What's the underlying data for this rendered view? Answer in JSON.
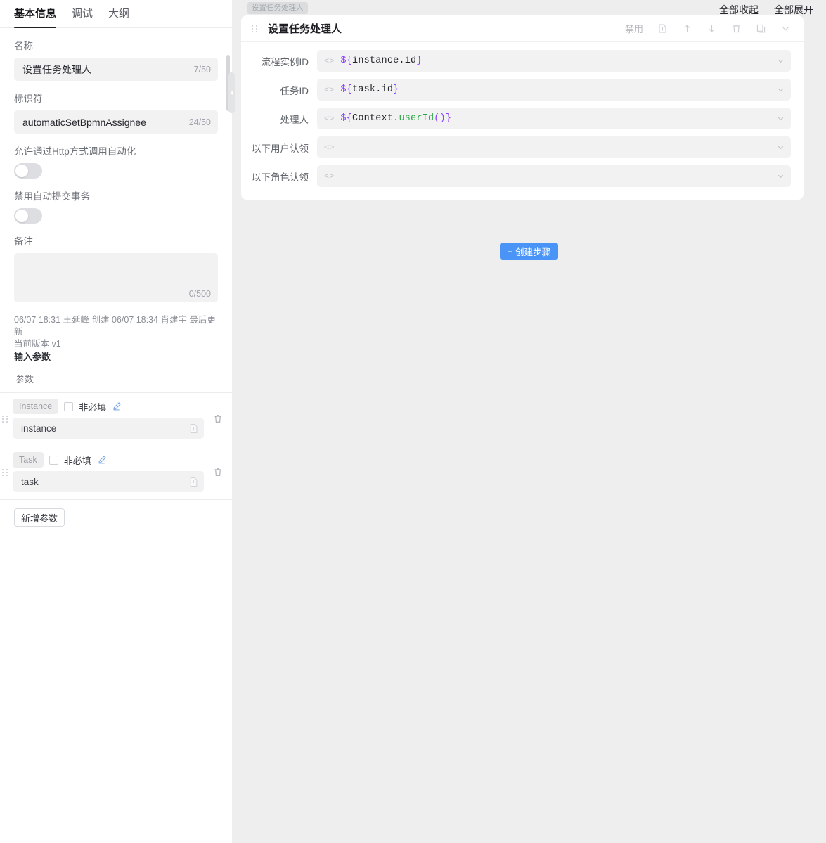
{
  "left": {
    "tabs": [
      {
        "label": "基本信息",
        "active": true
      },
      {
        "label": "调试",
        "active": false
      },
      {
        "label": "大纲",
        "active": false
      }
    ],
    "name": {
      "label": "名称",
      "value": "设置任务处理人",
      "counter": "7/50"
    },
    "identifier": {
      "label": "标识符",
      "value": "automaticSetBpmnAssignee",
      "counter": "24/50"
    },
    "http_toggle": {
      "label": "允许通过Http方式调用自动化",
      "state": "off"
    },
    "auto_commit_toggle": {
      "label": "禁用自动提交事务",
      "state": "off"
    },
    "remark": {
      "label": "备注",
      "value": "",
      "counter": "0/500"
    },
    "meta": {
      "history": "06/07 18:31 王延峰 创建 06/07 18:34 肖建宇 最后更新",
      "version": "当前版本 v1"
    },
    "input_params": {
      "title": "输入参数",
      "column_header": "参数",
      "add_button": "新增参数",
      "rows": [
        {
          "type": "Instance",
          "optional_label": "非必填",
          "optional_checked": false,
          "name": "instance"
        },
        {
          "type": "Task",
          "optional_label": "非必填",
          "optional_checked": false,
          "name": "task"
        }
      ]
    }
  },
  "right": {
    "top_actions": [
      {
        "label": "全部收起"
      },
      {
        "label": "全部展开"
      }
    ],
    "node_chip": "设置任务处理人",
    "card": {
      "title": "设置任务处理人",
      "disable_label": "禁用",
      "tools": [
        "note-icon",
        "arrow-up-icon",
        "arrow-down-icon",
        "trash-icon",
        "copy-icon",
        "chevron-down-icon"
      ],
      "fields": [
        {
          "label": "流程实例ID",
          "tokens": [
            {
              "t": "${",
              "c": "brace"
            },
            {
              "t": "instance.id",
              "c": "ident"
            },
            {
              "t": "}",
              "c": "brace"
            }
          ]
        },
        {
          "label": "任务ID",
          "tokens": [
            {
              "t": "${",
              "c": "brace"
            },
            {
              "t": "task.id",
              "c": "ident"
            },
            {
              "t": "}",
              "c": "brace"
            }
          ]
        },
        {
          "label": "处理人",
          "tokens": [
            {
              "t": "${",
              "c": "brace"
            },
            {
              "t": "Context",
              "c": "ident"
            },
            {
              "t": ".",
              "c": "dot"
            },
            {
              "t": "userId",
              "c": "fn"
            },
            {
              "t": "()}",
              "c": "brace"
            }
          ]
        },
        {
          "label": "以下用户认领",
          "tokens": []
        },
        {
          "label": "以下角色认领",
          "tokens": []
        }
      ]
    },
    "create_step": {
      "label": "创建步骤",
      "plus": "+"
    }
  },
  "colors": {
    "accent_blue": "#4a94f8",
    "panel_bg": "#eeeeee",
    "card_bg": "#ffffff",
    "input_bg": "#f2f2f3",
    "token_brace": "#8a3ffc",
    "token_fn": "#2aa745"
  }
}
